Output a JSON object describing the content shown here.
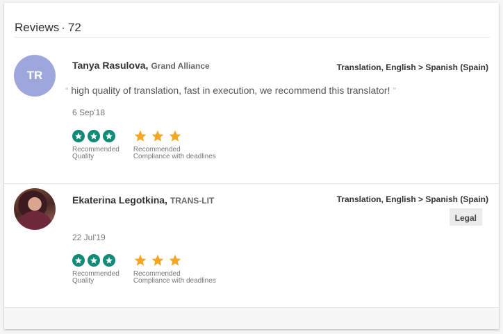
{
  "header": {
    "title": "Reviews",
    "separator": "·",
    "count": "72"
  },
  "reviews": [
    {
      "avatar_initials": "TR",
      "name": "Tanya Rasulova,",
      "company": "Grand Alliance",
      "service": "Translation, English > Spanish (Spain)",
      "quote": "high quality of translation, fast in execution, we recommend this translator!",
      "date": "6 Sep'18",
      "ratings": [
        {
          "label_line1": "Recommended",
          "label_line2": "Quality",
          "icon": "star-circle-icon",
          "count": 3
        },
        {
          "label_line1": "Recommended",
          "label_line2": "Compliance with deadlines",
          "icon": "star-icon",
          "count": 3
        }
      ]
    },
    {
      "avatar_initials": "",
      "name": "Ekaterina Legotkina,",
      "company": "TRANS-LIT",
      "service": "Translation, English > Spanish (Spain)",
      "tag": "Legal",
      "date": "22 Jul'19",
      "ratings": [
        {
          "label_line1": "Recommended",
          "label_line2": "Quality",
          "icon": "star-circle-icon",
          "count": 3
        },
        {
          "label_line1": "Recommended",
          "label_line2": "Compliance with deadlines",
          "icon": "star-icon",
          "count": 3
        }
      ]
    }
  ],
  "colors": {
    "teal": "#128a78",
    "gold": "#f5a623",
    "avatar_bg": "#9ea7db"
  }
}
